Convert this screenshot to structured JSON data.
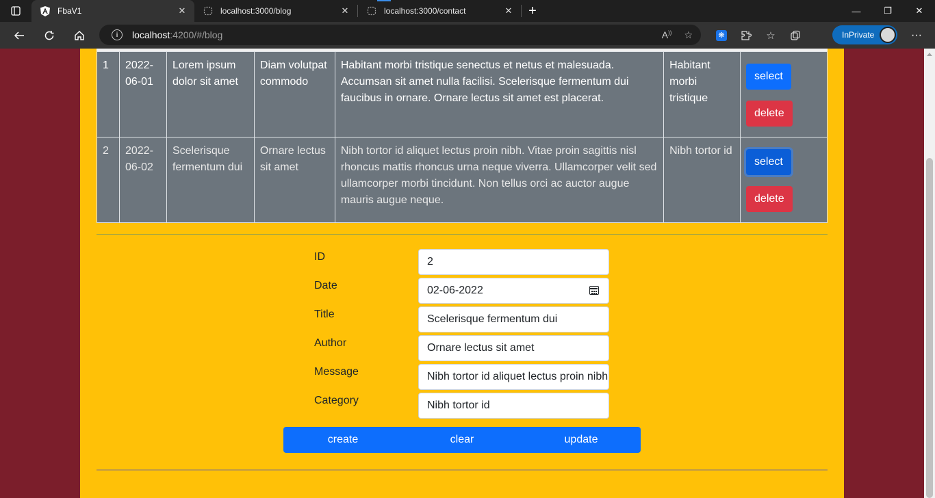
{
  "browser": {
    "tabs": [
      {
        "title": "FbaV1",
        "active": true,
        "icon": "angular-logo-icon"
      },
      {
        "title": "localhost:3000/blog",
        "active": false,
        "icon": "page-icon"
      },
      {
        "title": "localhost:3000/contact",
        "active": false,
        "icon": "page-icon"
      }
    ],
    "url_host": "localhost",
    "url_rest": ":4200/#/blog",
    "inprivate_label": "InPrivate"
  },
  "table": {
    "rows": [
      {
        "id": "1",
        "date": "2022-06-01",
        "title": "Lorem ipsum dolor sit amet",
        "author": "Diam volutpat commodo",
        "message": "Habitant morbi tristique senectus et netus et malesuada. Accumsan sit amet nulla facilisi. Scelerisque fermentum dui faucibus in ornare. Ornare lectus sit amet est placerat.",
        "category": "Habitant morbi tristique",
        "select_label": "select",
        "delete_label": "delete"
      },
      {
        "id": "2",
        "date": "2022-06-02",
        "title": "Scelerisque fermentum dui",
        "author": "Ornare lectus sit amet",
        "message": "Nibh tortor id aliquet lectus proin nibh. Vitae proin sagittis nisl rhoncus mattis rhoncus urna neque viverra. Ullamcorper velit sed ullamcorper morbi tincidunt. Non tellus orci ac auctor augue mauris augue neque.",
        "category": "Nibh tortor id",
        "select_label": "select",
        "delete_label": "delete"
      }
    ]
  },
  "form": {
    "id_label": "ID",
    "id_value": "2",
    "date_label": "Date",
    "date_value": "02-06-2022",
    "title_label": "Title",
    "title_value": "Scelerisque fermentum dui",
    "author_label": "Author",
    "author_value": "Ornare lectus sit amet",
    "message_label": "Message",
    "message_value": "Nibh tortor id aliquet lectus proin nibh.",
    "category_label": "Category",
    "category_value": "Nibh tortor id"
  },
  "buttons": {
    "create": "create",
    "clear": "clear",
    "update": "update"
  },
  "colors": {
    "page_bg": "#7b1e2b",
    "content_bg": "#ffc107",
    "table_bg": "#6c757d",
    "primary": "#0d6efd",
    "danger": "#dc3545"
  }
}
